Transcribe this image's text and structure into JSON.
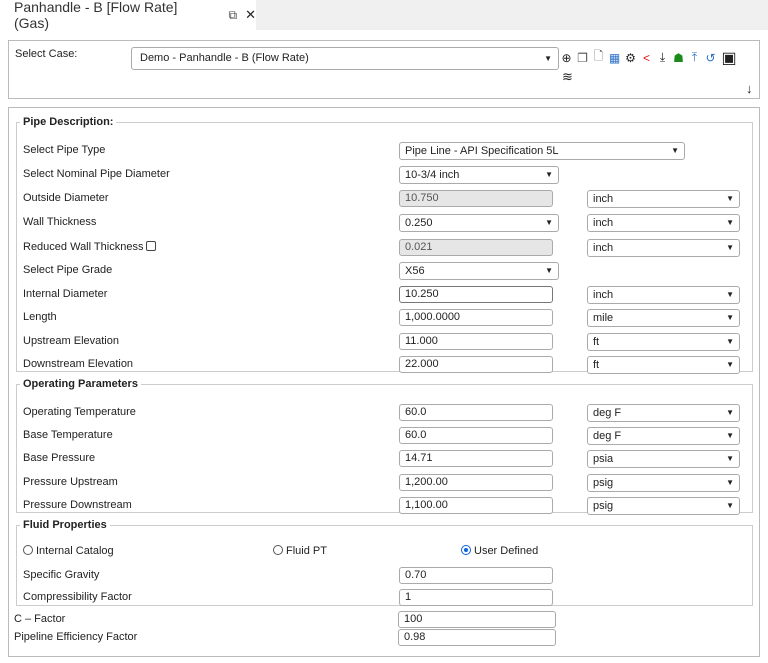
{
  "tab": {
    "title": "Panhandle - B [Flow Rate] (Gas)",
    "popout_icon": "popout-icon",
    "close_icon": "close-icon"
  },
  "case": {
    "label": "Select Case:",
    "value": "Demo - Panhandle - B (Flow Rate)"
  },
  "toolbar": {
    "icons": [
      "add-icon",
      "copy-icon",
      "pdf-file-icon",
      "calculator-icon",
      "gear-icon",
      "share-icon",
      "download-icon",
      "hierarchy-icon",
      "upload-icon",
      "history-icon",
      "pdf-stack-icon",
      "pipe-settings-icon",
      "arrow-down-icon"
    ]
  },
  "pipe": {
    "legend": "Pipe Description:",
    "pipe_type": {
      "label": "Select Pipe Type",
      "value": "Pipe Line - API Specification 5L"
    },
    "nominal": {
      "label": "Select Nominal Pipe Diameter",
      "value": "10-3/4 inch"
    },
    "od": {
      "label": "Outside Diameter",
      "value": "10.750",
      "unit": "inch"
    },
    "wall": {
      "label": "Wall Thickness",
      "value": "0.250",
      "unit": "inch"
    },
    "reduced": {
      "label": "Reduced Wall Thickness",
      "value": "0.021",
      "unit": "inch"
    },
    "grade": {
      "label": "Select Pipe Grade",
      "value": "X56"
    },
    "id": {
      "label": "Internal Diameter",
      "value": "10.250",
      "unit": "inch"
    },
    "length": {
      "label": "Length",
      "value": "1,000.0000",
      "unit": "mile"
    },
    "up_elev": {
      "label": "Upstream Elevation",
      "value": "11.000",
      "unit": "ft"
    },
    "down_elev": {
      "label": "Downstream Elevation",
      "value": "22.000",
      "unit": "ft"
    }
  },
  "op": {
    "legend": "Operating Parameters",
    "temp": {
      "label": "Operating Temperature",
      "value": "60.0",
      "unit": "deg F"
    },
    "base_temp": {
      "label": "Base Temperature",
      "value": "60.0",
      "unit": "deg F"
    },
    "base_p": {
      "label": "Base Pressure",
      "value": "14.71",
      "unit": "psia"
    },
    "p_up": {
      "label": "Pressure Upstream",
      "value": "1,200.00",
      "unit": "psig"
    },
    "p_down": {
      "label": "Pressure Downstream",
      "value": "1,100.00",
      "unit": "psig"
    }
  },
  "fluid": {
    "legend": "Fluid Properties",
    "radio_internal": "Internal Catalog",
    "radio_pt": "Fluid PT",
    "radio_user": "User Defined",
    "sg": {
      "label": "Specific Gravity",
      "value": "0.70"
    },
    "z": {
      "label": "Compressibility Factor",
      "value": "1"
    }
  },
  "cfactor": {
    "label": "C – Factor",
    "value": "100"
  },
  "eff": {
    "label": "Pipeline Efficiency Factor",
    "value": "0.98"
  }
}
